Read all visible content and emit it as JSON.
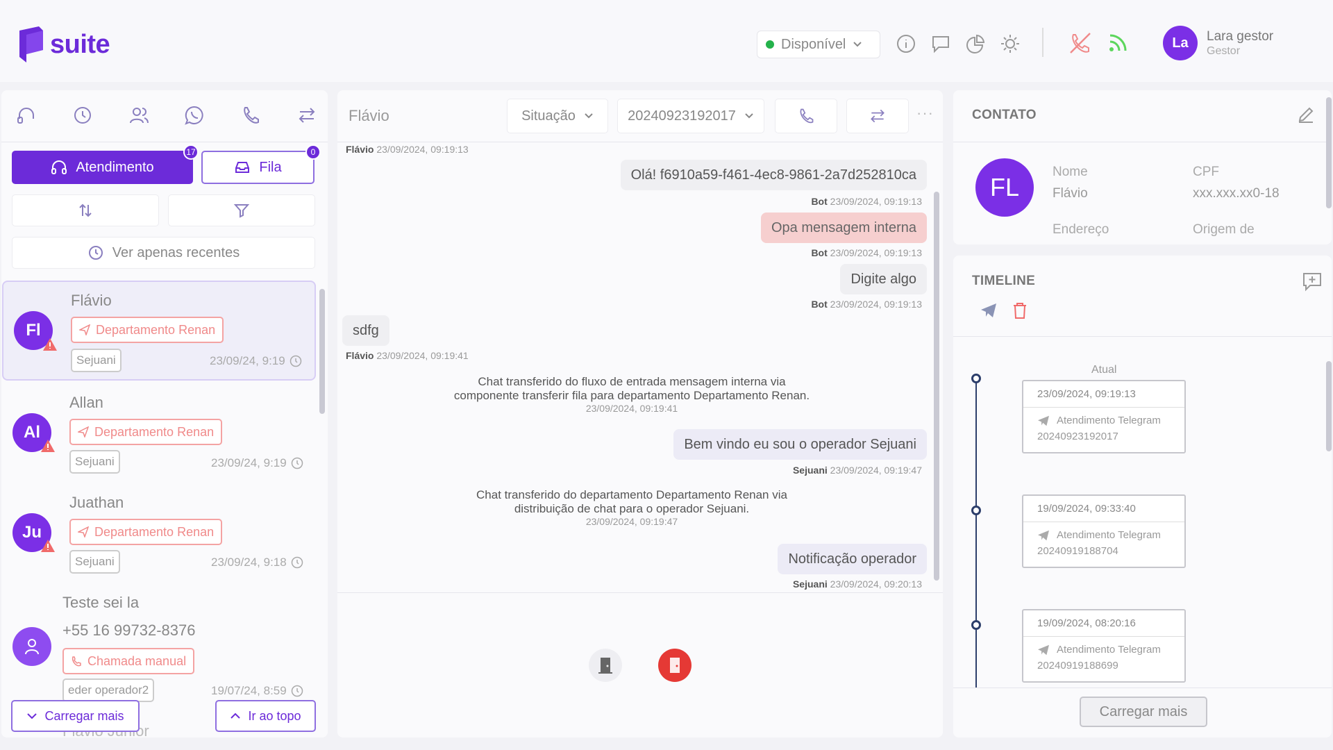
{
  "header": {
    "logo_text": "suite",
    "status": "Disponível",
    "user": {
      "initials": "La",
      "name": "Lara gestor",
      "role": "Gestor"
    }
  },
  "left": {
    "tabs": {
      "atendimento": "Atendimento",
      "atendimento_badge": "17",
      "fila": "Fila",
      "fila_badge": "0"
    },
    "recent_label": "Ver apenas recentes",
    "contacts": [
      {
        "initials": "Fl",
        "name": "Flávio",
        "dept": "Departamento Renan",
        "operator": "Sejuani",
        "date": "23/09/24, 9:19"
      },
      {
        "initials": "Al",
        "name": "Allan",
        "dept": "Departamento Renan",
        "operator": "Sejuani",
        "date": "23/09/24, 9:19"
      },
      {
        "initials": "Ju",
        "name": "Juathan",
        "dept": "Departamento Renan",
        "operator": "Sejuani",
        "date": "23/09/24, 9:18"
      },
      {
        "name": "Teste sei la",
        "phone": "+55 16 99732-8376",
        "dept": "Chamada manual",
        "operator": "eder operador2",
        "date": "19/07/24, 8:59"
      },
      {
        "name": "Flavio Junior"
      }
    ],
    "load_more": "Carregar mais",
    "go_top": "Ir ao topo"
  },
  "chat": {
    "title": "Flávio",
    "situacao": "Situação",
    "protocol": "20240923192017",
    "messages": [
      {
        "kind": "meta",
        "author": "Flávio",
        "time": "23/09/2024, 09:19:13"
      },
      {
        "kind": "out",
        "text": "Olá! f6910a59-f461-4ec8-9861-2a7d252810ca",
        "author": "Bot",
        "time": "23/09/2024, 09:19:13"
      },
      {
        "kind": "out-internal",
        "text": "Opa mensagem interna",
        "author": "Bot",
        "time": "23/09/2024, 09:19:13"
      },
      {
        "kind": "out",
        "text": "Digite algo",
        "author": "Bot",
        "time": "23/09/2024, 09:19:13"
      },
      {
        "kind": "in",
        "text": "sdfg",
        "author": "Flávio",
        "time": "23/09/2024, 09:19:41"
      },
      {
        "kind": "system",
        "line1": "Chat transferido do fluxo de entrada mensagem interna via",
        "line2": "componente transferir fila  para departamento Departamento Renan.",
        "time": "23/09/2024, 09:19:41"
      },
      {
        "kind": "out-op",
        "text": "Bem vindo eu sou o operador Sejuani",
        "author": "Sejuani",
        "time": "23/09/2024, 09:19:47"
      },
      {
        "kind": "system",
        "line1": "Chat transferido do departamento Departamento Renan via",
        "line2": "distribuição de chat para o operador Sejuani.",
        "time": "23/09/2024, 09:19:47"
      },
      {
        "kind": "out-op",
        "text": "Notificação operador",
        "author": "Sejuani",
        "time": "23/09/2024, 09:20:13"
      }
    ]
  },
  "contact": {
    "title": "CONTATO",
    "initials": "FL",
    "fields": {
      "nome_label": "Nome",
      "nome": "Flávio",
      "cpf_label": "CPF",
      "cpf": "xxx.xxx.xx0-18",
      "endereco_label": "Endereço",
      "origem_label": "Origem de"
    }
  },
  "timeline": {
    "title": "TIMELINE",
    "current_label": "Atual",
    "items": [
      {
        "date": "23/09/2024,  09:19:13",
        "channel": "Atendimento Telegram",
        "id": "20240923192017"
      },
      {
        "date": "19/09/2024,  09:33:40",
        "channel": "Atendimento Telegram",
        "id": "20240919188704"
      },
      {
        "date": "19/09/2024,  08:20:16",
        "channel": "Atendimento Telegram",
        "id": "20240919188699"
      }
    ],
    "load_more": "Carregar mais"
  },
  "colors": {
    "primary": "#6c2bd9",
    "danger": "#e53935",
    "online": "#24b24b"
  }
}
